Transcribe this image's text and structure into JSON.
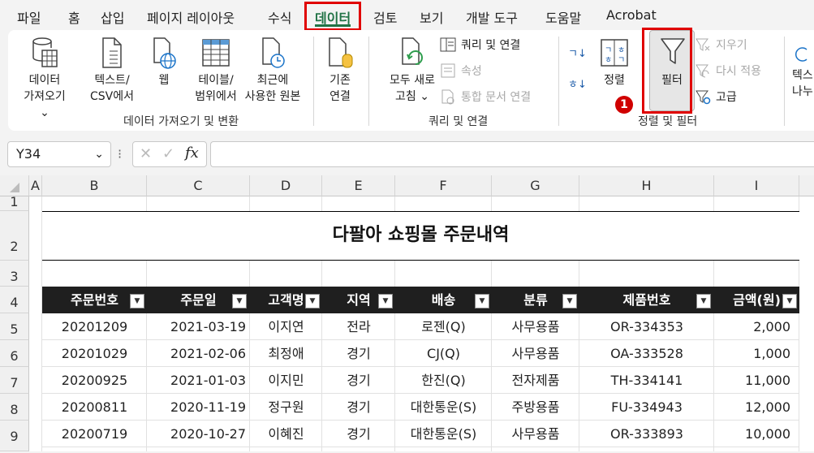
{
  "menu": {
    "items": [
      "파일",
      "홈",
      "삽입",
      "페이지 레이아웃",
      "수식",
      "데이터",
      "검토",
      "보기",
      "개발 도구",
      "도움말",
      "Acrobat"
    ],
    "active_index": 5
  },
  "ribbon": {
    "get_data": {
      "line1": "데이터",
      "line2": "가져오기 ⌄"
    },
    "text_csv": {
      "line1": "텍스트/",
      "line2": "CSV에서"
    },
    "web": {
      "label": "웹"
    },
    "from_table": {
      "line1": "테이블/",
      "line2": "범위에서"
    },
    "recent_sources": {
      "line1": "최근에",
      "line2": "사용한 원본"
    },
    "existing_conn": {
      "line1": "기존",
      "line2": "연결"
    },
    "refresh_all": {
      "line1": "모두 새로",
      "line2": "고침 ⌄"
    },
    "queries_connections": "쿼리 및 연결",
    "properties": "속성",
    "edit_links": "통합 문서 연결",
    "sort_label": "정렬",
    "filter_label": "필터",
    "clear_label": "지우기",
    "reapply_label": "다시 적용",
    "advanced_label": "고급",
    "text_to_col": {
      "line1": "텍스",
      "line2": "나누"
    },
    "group_labels": {
      "get_transform": "데이터 가져오기 및 변환",
      "queries": "쿼리 및 연결",
      "sort_filter": "정렬 및 필터"
    },
    "badge": "1",
    "accent_color": "#217346",
    "highlight_color": "#e00000"
  },
  "formula_bar": {
    "name_box": "Y34",
    "fx": "fx",
    "value": ""
  },
  "grid": {
    "columns": [
      "A",
      "B",
      "C",
      "D",
      "E",
      "F",
      "G",
      "H",
      "I"
    ],
    "rows": [
      "1",
      "2",
      "3",
      "4",
      "5",
      "6",
      "7",
      "8",
      "9"
    ],
    "title": "다팔아 쇼핑몰 주문내역",
    "headers": [
      "주문번호",
      "주문일",
      "고객명",
      "지역",
      "배송",
      "분류",
      "제품번호",
      "금액(원)"
    ],
    "data": [
      [
        "20201209",
        "2021-03-19",
        "이지연",
        "전라",
        "로젠(Q)",
        "사무용품",
        "OR-334353",
        "2,000"
      ],
      [
        "20201029",
        "2021-02-06",
        "최정애",
        "경기",
        "CJ(Q)",
        "사무용품",
        "OA-333528",
        "1,000"
      ],
      [
        "20200925",
        "2021-01-03",
        "이지민",
        "경기",
        "한진(Q)",
        "전자제품",
        "TH-334141",
        "11,000"
      ],
      [
        "20200811",
        "2020-11-19",
        "정구원",
        "경기",
        "대한통운(S)",
        "주방용품",
        "FU-334943",
        "12,000"
      ],
      [
        "20200719",
        "2020-10-27",
        "이혜진",
        "경기",
        "대한통운(S)",
        "사무용품",
        "OR-333893",
        "10,000"
      ]
    ]
  }
}
